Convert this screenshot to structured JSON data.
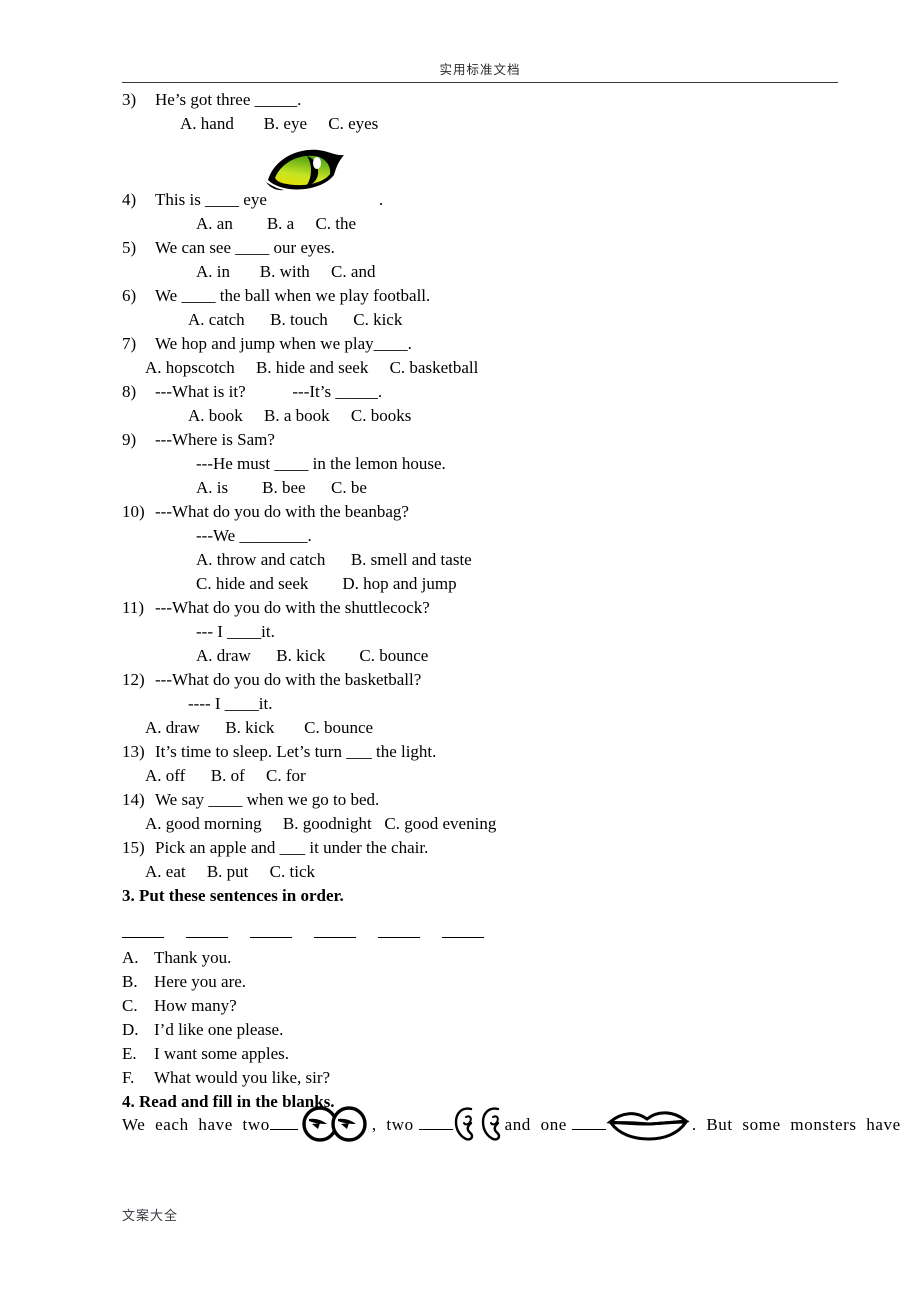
{
  "header": {
    "title": "实用标准文档"
  },
  "footer": {
    "text": "文案大全"
  },
  "questions": [
    {
      "number": "3)",
      "stem": "He’s got three _____.",
      "options": "A. hand       B. eye     C. eyes"
    },
    {
      "number": "4)",
      "stem": "This is ____ eye",
      "stem_tail": ".",
      "options": "A. an        B. a     C. the",
      "image": "cat-eye-image"
    },
    {
      "number": "5)",
      "stem": "We can see ____ our eyes.",
      "options": "A. in       B. with     C. and"
    },
    {
      "number": "6)",
      "stem": "We ____ the ball when we play football.",
      "options": "A. catch      B. touch      C. kick"
    },
    {
      "number": "7)",
      "stem": "We hop and jump when we play____.",
      "options": "A. hopscotch     B. hide and seek     C. basketball"
    },
    {
      "number": "8)",
      "stem": "---What is it?           ---It’s _____.",
      "options": "A. book     B. a book     C. books"
    },
    {
      "number": "9)",
      "stem": "---Where is Sam?",
      "sub": "---He must ____ in the lemon house.",
      "options": "A. is        B. bee      C. be"
    },
    {
      "number": "10)",
      "stem": "---What do you do with the beanbag?",
      "sub": "---We ________.",
      "options": "A. throw and catch      B. smell and taste",
      "options2": "C. hide and seek        D. hop and jump"
    },
    {
      "number": "11)",
      "stem": "---What do you do with the shuttlecock?",
      "sub": "--- I ____it.",
      "options": "A. draw      B. kick        C. bounce"
    },
    {
      "number": "12)",
      "stem": "---What do you do with the basketball?",
      "sub": "---- I ____it.",
      "options": "A. draw      B. kick       C. bounce"
    },
    {
      "number": "13)",
      "stem": "It’s time to sleep. Let’s turn ___ the light.",
      "options": "A. off      B. of     C. for"
    },
    {
      "number": "14)",
      "stem": "We say ____ when we go to bed.",
      "options": "A. good morning     B. goodnight   C. good evening"
    },
    {
      "number": "15)",
      "stem": "Pick an apple and ___ it under the chair.",
      "options": "A. eat     B. put     C. tick"
    }
  ],
  "section3": {
    "heading": "3. Put these sentences in order.",
    "blank_count": 6,
    "items": [
      {
        "label": "A.",
        "text": "Thank you."
      },
      {
        "label": "B.",
        "text": "Here you are."
      },
      {
        "label": "C.",
        "text": "How many?"
      },
      {
        "label": "D.",
        "text": "I’d like one please."
      },
      {
        "label": "E.",
        "text": "I want some apples."
      },
      {
        "label": "F.",
        "text": "What would you like, sir?"
      }
    ]
  },
  "section4": {
    "heading": "4. Read and fill in the blanks.",
    "sentence_part1": "We  each  have  two",
    "sentence_part2": ",  two ",
    "sentence_part3": "and  one ",
    "sentence_part4": ".  But  some  monsters  have",
    "images": [
      "two-eyes-image",
      "two-ears-image",
      "lips-image"
    ]
  },
  "colors": {
    "text": "#000000",
    "rule": "#3a3a44",
    "eye_iris_light": "#b6e02a",
    "eye_iris_dark": "#3f8f12",
    "eye_outline": "#000000"
  }
}
